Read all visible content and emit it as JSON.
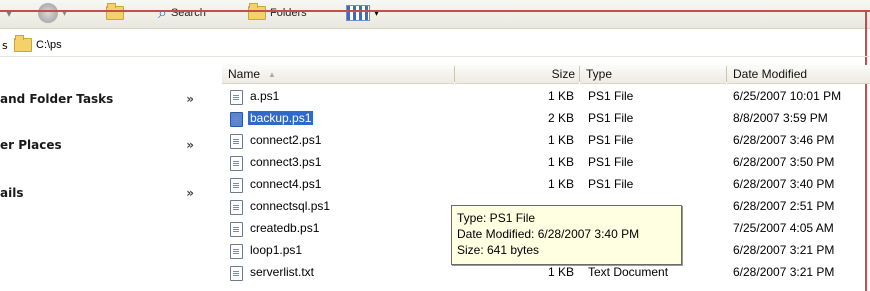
{
  "toolbar": {
    "search_label": "Search",
    "folders_label": "Folders"
  },
  "address": {
    "label": "s",
    "path": "C:\\ps"
  },
  "tasks": [
    {
      "label": "and Folder Tasks",
      "chev": "»"
    },
    {
      "label": "er Places",
      "chev": "»"
    },
    {
      "label": "ails",
      "chev": "»"
    }
  ],
  "columns": {
    "name": "Name",
    "sort": "▲",
    "size": "Size",
    "type": "Type",
    "date": "Date Modified"
  },
  "files": [
    {
      "name": "a.ps1",
      "size": "1 KB",
      "type": "PS1 File",
      "date": "6/25/2007 10:01 PM"
    },
    {
      "name": "backup.ps1",
      "size": "2 KB",
      "type": "PS1 File",
      "date": "8/8/2007 3:59 PM"
    },
    {
      "name": "connect2.ps1",
      "size": "1 KB",
      "type": "PS1 File",
      "date": "6/28/2007 3:46 PM"
    },
    {
      "name": "connect3.ps1",
      "size": "1 KB",
      "type": "PS1 File",
      "date": "6/28/2007 3:50 PM"
    },
    {
      "name": "connect4.ps1",
      "size": "1 KB",
      "type": "PS1 File",
      "date": "6/28/2007 3:40 PM"
    },
    {
      "name": "connectsql.ps1",
      "size": "",
      "type": "",
      "date": "6/28/2007 2:51 PM"
    },
    {
      "name": "createdb.ps1",
      "size": "",
      "type": "",
      "date": "7/25/2007 4:05 AM"
    },
    {
      "name": "loop1.ps1",
      "size": "",
      "type": "",
      "date": "6/28/2007 3:21 PM"
    },
    {
      "name": "serverlist.txt",
      "size": "1 KB",
      "type": "Text Document",
      "date": "6/28/2007 3:21 PM"
    }
  ],
  "tooltip": {
    "type": "Type: PS1 File",
    "modified": "Date Modified: 6/28/2007 3:40 PM",
    "size": "Size: 641 bytes"
  },
  "colors": {
    "selection": "#3169c6",
    "tooltip_bg": "#ffffe1",
    "annotation_red": "#c0504d"
  }
}
